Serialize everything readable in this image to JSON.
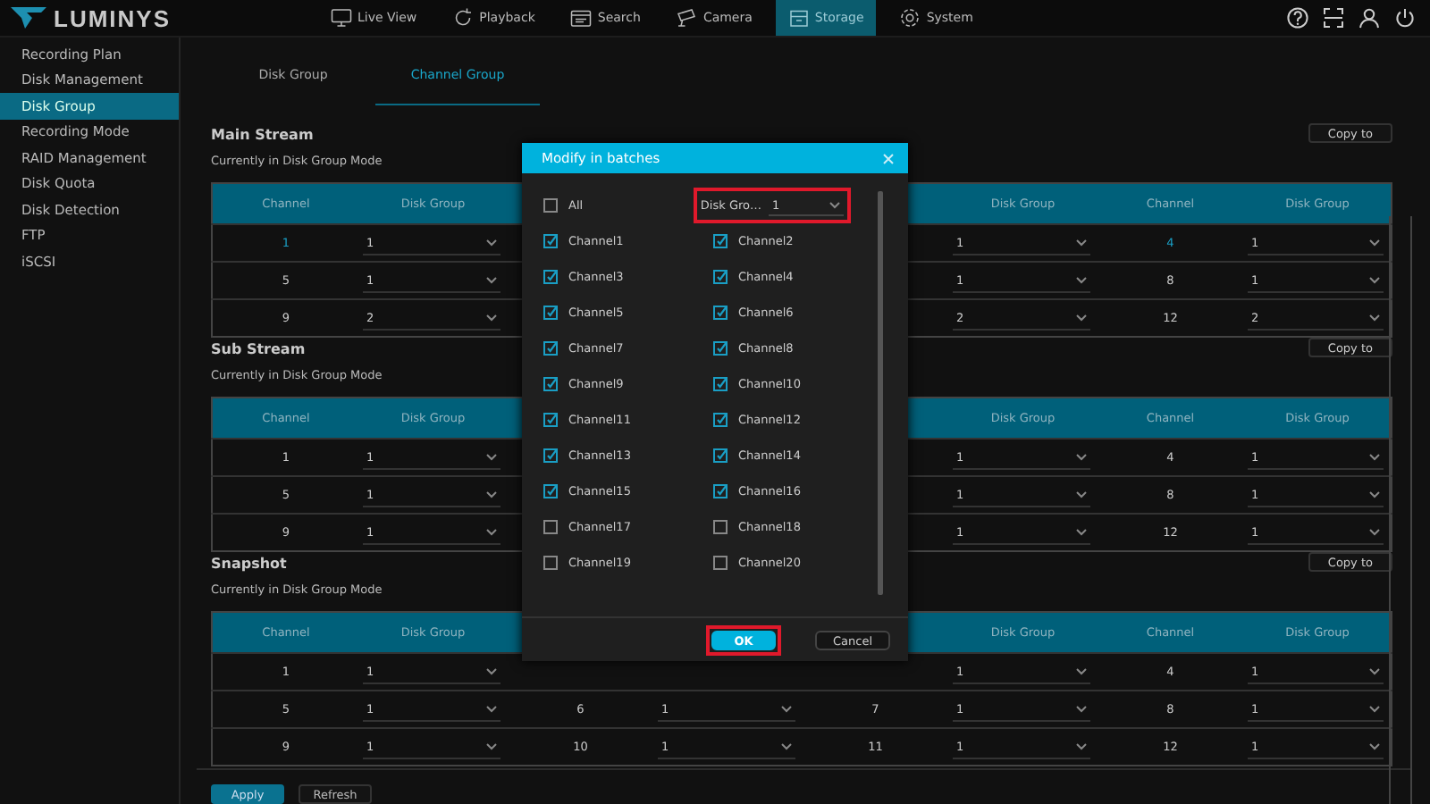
{
  "brand": {
    "name": "LUMINYS"
  },
  "nav": [
    {
      "label": "Live View",
      "selected": false
    },
    {
      "label": "Playback",
      "selected": false
    },
    {
      "label": "Search",
      "selected": false
    },
    {
      "label": "Camera",
      "selected": false
    },
    {
      "label": "Storage",
      "selected": true
    },
    {
      "label": "System",
      "selected": false
    }
  ],
  "sidebar": {
    "items": [
      {
        "label": "Recording Plan",
        "selected": false
      },
      {
        "label": "Disk Management",
        "selected": false
      },
      {
        "label": "Disk Group",
        "selected": true
      },
      {
        "label": "Recording Mode",
        "selected": false
      },
      {
        "label": "RAID Management",
        "selected": false
      },
      {
        "label": "Disk Quota",
        "selected": false
      },
      {
        "label": "Disk Detection",
        "selected": false
      },
      {
        "label": "FTP",
        "selected": false
      },
      {
        "label": "iSCSI",
        "selected": false
      }
    ]
  },
  "tabs": [
    {
      "label": "Disk Group",
      "selected": false
    },
    {
      "label": "Channel Group",
      "selected": true
    }
  ],
  "sections": [
    {
      "title": "Main Stream",
      "subtitle": "Currently in Disk Group Mode",
      "copy_button": "Copy to",
      "table": {
        "columns": [
          "Channel",
          "Disk Group",
          null,
          null,
          null,
          "Disk Group",
          "Channel",
          "Disk Group"
        ],
        "rows": [
          [
            {
              "kind": "channel",
              "text": "1",
              "highlighted": true
            },
            {
              "kind": "select",
              "value": "1"
            },
            null,
            null,
            null,
            {
              "kind": "select",
              "value": "1"
            },
            {
              "kind": "channel",
              "text": "4",
              "highlighted": true
            },
            {
              "kind": "select",
              "value": "1"
            }
          ],
          [
            {
              "kind": "channel",
              "text": "5",
              "highlighted": false
            },
            {
              "kind": "select",
              "value": "1"
            },
            null,
            null,
            null,
            {
              "kind": "select",
              "value": "1"
            },
            {
              "kind": "channel",
              "text": "8",
              "highlighted": false
            },
            {
              "kind": "select",
              "value": "1"
            }
          ],
          [
            {
              "kind": "channel",
              "text": "9",
              "highlighted": false
            },
            {
              "kind": "select",
              "value": "2"
            },
            null,
            null,
            null,
            {
              "kind": "select",
              "value": "2"
            },
            {
              "kind": "channel",
              "text": "12",
              "highlighted": false
            },
            {
              "kind": "select",
              "value": "2"
            }
          ]
        ]
      }
    },
    {
      "title": "Sub Stream",
      "subtitle": "Currently in Disk Group Mode",
      "copy_button": "Copy to",
      "table": {
        "columns": [
          "Channel",
          "Disk Group",
          null,
          null,
          null,
          "Disk Group",
          "Channel",
          "Disk Group"
        ],
        "rows": [
          [
            {
              "kind": "channel",
              "text": "1",
              "highlighted": false
            },
            {
              "kind": "select",
              "value": "1"
            },
            null,
            null,
            null,
            {
              "kind": "select",
              "value": "1"
            },
            {
              "kind": "channel",
              "text": "4",
              "highlighted": false
            },
            {
              "kind": "select",
              "value": "1"
            }
          ],
          [
            {
              "kind": "channel",
              "text": "5",
              "highlighted": false
            },
            {
              "kind": "select",
              "value": "1"
            },
            null,
            null,
            null,
            {
              "kind": "select",
              "value": "1"
            },
            {
              "kind": "channel",
              "text": "8",
              "highlighted": false
            },
            {
              "kind": "select",
              "value": "1"
            }
          ],
          [
            {
              "kind": "channel",
              "text": "9",
              "highlighted": false
            },
            {
              "kind": "select",
              "value": "1"
            },
            null,
            null,
            null,
            {
              "kind": "select",
              "value": "1"
            },
            {
              "kind": "channel",
              "text": "12",
              "highlighted": false
            },
            {
              "kind": "select",
              "value": "1"
            }
          ]
        ]
      }
    },
    {
      "title": "Snapshot",
      "subtitle": "Currently in Disk Group Mode",
      "copy_button": "Copy to",
      "table": {
        "columns": [
          "Channel",
          "Disk Group",
          null,
          null,
          null,
          "Disk Group",
          "Channel",
          "Disk Group"
        ],
        "rows": [
          [
            {
              "kind": "channel",
              "text": "1",
              "highlighted": false
            },
            {
              "kind": "select",
              "value": "1"
            },
            null,
            null,
            null,
            {
              "kind": "select",
              "value": "1"
            },
            {
              "kind": "channel",
              "text": "4",
              "highlighted": false
            },
            {
              "kind": "select",
              "value": "1"
            }
          ],
          [
            {
              "kind": "channel",
              "text": "5",
              "highlighted": false
            },
            {
              "kind": "select",
              "value": "1"
            },
            {
              "kind": "channel",
              "text": "6",
              "highlighted": false
            },
            {
              "kind": "select",
              "value": "1"
            },
            {
              "kind": "channel",
              "text": "7",
              "highlighted": false
            },
            {
              "kind": "select",
              "value": "1"
            },
            {
              "kind": "channel",
              "text": "8",
              "highlighted": false
            },
            {
              "kind": "select",
              "value": "1"
            }
          ],
          [
            {
              "kind": "channel",
              "text": "9",
              "highlighted": false
            },
            {
              "kind": "select",
              "value": "1"
            },
            {
              "kind": "channel",
              "text": "10",
              "highlighted": false
            },
            {
              "kind": "select",
              "value": "1"
            },
            {
              "kind": "channel",
              "text": "11",
              "highlighted": false
            },
            {
              "kind": "select",
              "value": "1"
            },
            {
              "kind": "channel",
              "text": "12",
              "highlighted": false
            },
            {
              "kind": "select",
              "value": "1"
            }
          ]
        ]
      }
    }
  ],
  "footer_buttons": [
    {
      "label": "Apply",
      "kind": "primary"
    },
    {
      "label": "Refresh",
      "kind": "secondary"
    }
  ],
  "dialog": {
    "title": "Modify in batches",
    "all": {
      "label": "All",
      "checked": false
    },
    "disk_group": {
      "label": "Disk Gro…",
      "value": "1",
      "marked": true
    },
    "channels": [
      {
        "label": "Channel1",
        "checked": true
      },
      {
        "label": "Channel2",
        "checked": true
      },
      {
        "label": "Channel3",
        "checked": true
      },
      {
        "label": "Channel4",
        "checked": true
      },
      {
        "label": "Channel5",
        "checked": true
      },
      {
        "label": "Channel6",
        "checked": true
      },
      {
        "label": "Channel7",
        "checked": true
      },
      {
        "label": "Channel8",
        "checked": true
      },
      {
        "label": "Channel9",
        "checked": true
      },
      {
        "label": "Channel10",
        "checked": true
      },
      {
        "label": "Channel11",
        "checked": true
      },
      {
        "label": "Channel12",
        "checked": true
      },
      {
        "label": "Channel13",
        "checked": true
      },
      {
        "label": "Channel14",
        "checked": true
      },
      {
        "label": "Channel15",
        "checked": true
      },
      {
        "label": "Channel16",
        "checked": true
      },
      {
        "label": "Channel17",
        "checked": false
      },
      {
        "label": "Channel18",
        "checked": false
      },
      {
        "label": "Channel19",
        "checked": false
      },
      {
        "label": "Channel20",
        "checked": false
      }
    ],
    "buttons": [
      {
        "label": "OK",
        "kind": "primary",
        "marked": true
      },
      {
        "label": "Cancel",
        "kind": "secondary",
        "marked": false
      }
    ]
  }
}
